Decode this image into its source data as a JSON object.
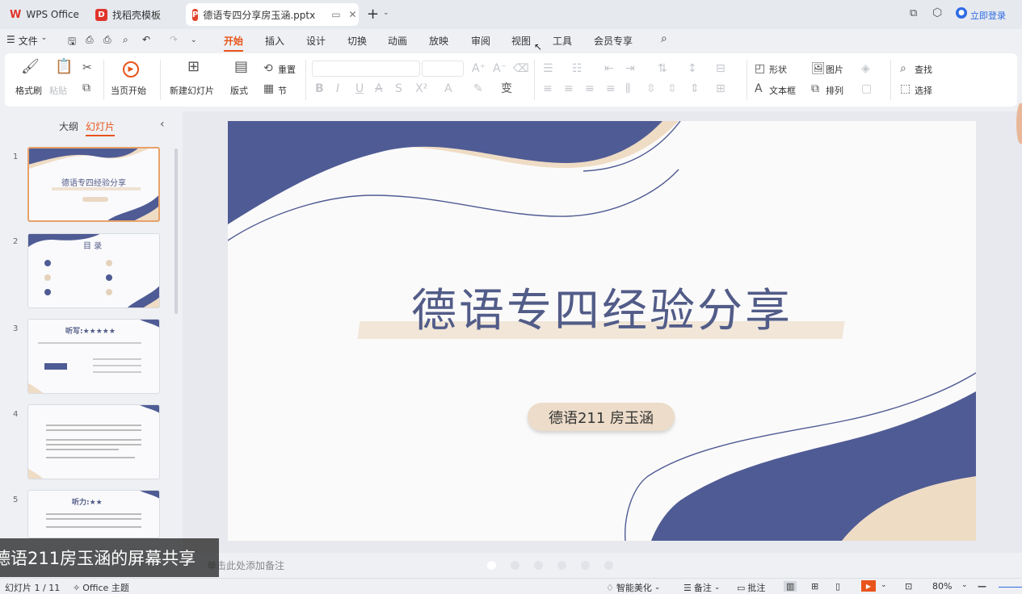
{
  "tabs": [
    {
      "label": "WPS Office",
      "icon": "wps-logo-icon"
    },
    {
      "label": "找稻壳模板",
      "icon": "docer-template-icon"
    },
    {
      "label": "德语专四分享房玉涵.pptx",
      "icon": "pptx-file-icon",
      "active": true
    }
  ],
  "login_label": "立即登录",
  "menu": {
    "file_label": "文件",
    "items": [
      "开始",
      "插入",
      "设计",
      "切换",
      "动画",
      "放映",
      "审阅",
      "视图",
      "工具",
      "会员专享"
    ],
    "active": "开始"
  },
  "ribbon": {
    "format_painter": "格式刷",
    "paste": "粘贴",
    "play_from_current": "当页开始",
    "new_slide": "新建幻灯片",
    "layout": "版式",
    "reset": "重置",
    "section": "节",
    "shape": "形状",
    "picture": "图片",
    "textbox": "文本框",
    "arrange": "排列",
    "find": "查找",
    "select": "选择"
  },
  "left_pane": {
    "outline_tab": "大纲",
    "slides_tab": "幻灯片",
    "thumbs": [
      {
        "num": "1",
        "title": "德语专四经验分享"
      },
      {
        "num": "2",
        "title": "目 录"
      },
      {
        "num": "3",
        "title": "听写:★★★★★"
      },
      {
        "num": "4",
        "title": ""
      },
      {
        "num": "5",
        "title": "听力:★★"
      }
    ]
  },
  "slide": {
    "title": "德语专四经验分享",
    "subtitle": "德语211 房玉涵"
  },
  "notes_placeholder": "单击此处添加备注",
  "share_banner": "德语211房玉涵的屏幕共享",
  "status": {
    "slide_count": "幻灯片 1 / 11",
    "theme": "Office 主题",
    "beautify": "智能美化",
    "notes": "备注",
    "comments": "批注",
    "zoom": "80%"
  },
  "colors": {
    "accent_orange": "#e8541a",
    "wave_navy": "#4f5b94",
    "wave_beige": "#efdcc5",
    "title_navy": "#525c88"
  }
}
